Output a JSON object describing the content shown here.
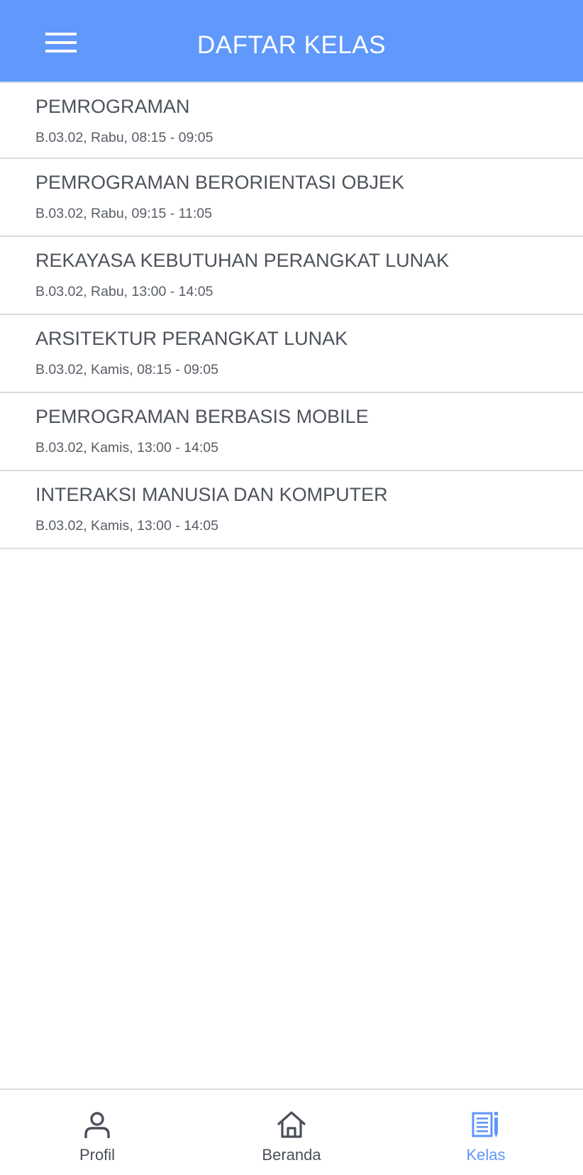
{
  "header": {
    "title": "DAFTAR KELAS",
    "menu_icon": "hamburger-menu-icon",
    "background_color": "#6098fc"
  },
  "classes": [
    {
      "name": "PEMROGRAMAN",
      "details": "B.03.02, Rabu, 08:15 - 09:05"
    },
    {
      "name": "PEMROGRAMAN BERORIENTASI OBJEK",
      "details": "B.03.02, Rabu, 09:15 - 11:05"
    },
    {
      "name": "REKAYASA KEBUTUHAN PERANGKAT LUNAK",
      "details": "B.03.02, Rabu, 13:00 - 14:05"
    },
    {
      "name": "ARSITEKTUR PERANGKAT LUNAK",
      "details": "B.03.02, Kamis, 08:15 - 09:05"
    },
    {
      "name": "PEMROGRAMAN BERBASIS MOBILE",
      "details": "B.03.02, Kamis, 13:00 - 14:05"
    },
    {
      "name": "INTERAKSI MANUSIA DAN KOMPUTER",
      "details": "B.03.02, Kamis, 13:00 - 14:05"
    }
  ],
  "bottom_nav": {
    "items": [
      {
        "label": "Profil",
        "icon": "person-icon",
        "active": false
      },
      {
        "label": "Beranda",
        "icon": "home-icon",
        "active": false
      },
      {
        "label": "Kelas",
        "icon": "class-list-icon",
        "active": true
      }
    ],
    "active_color": "#5f96fb",
    "inactive_color": "#4a4f58"
  }
}
